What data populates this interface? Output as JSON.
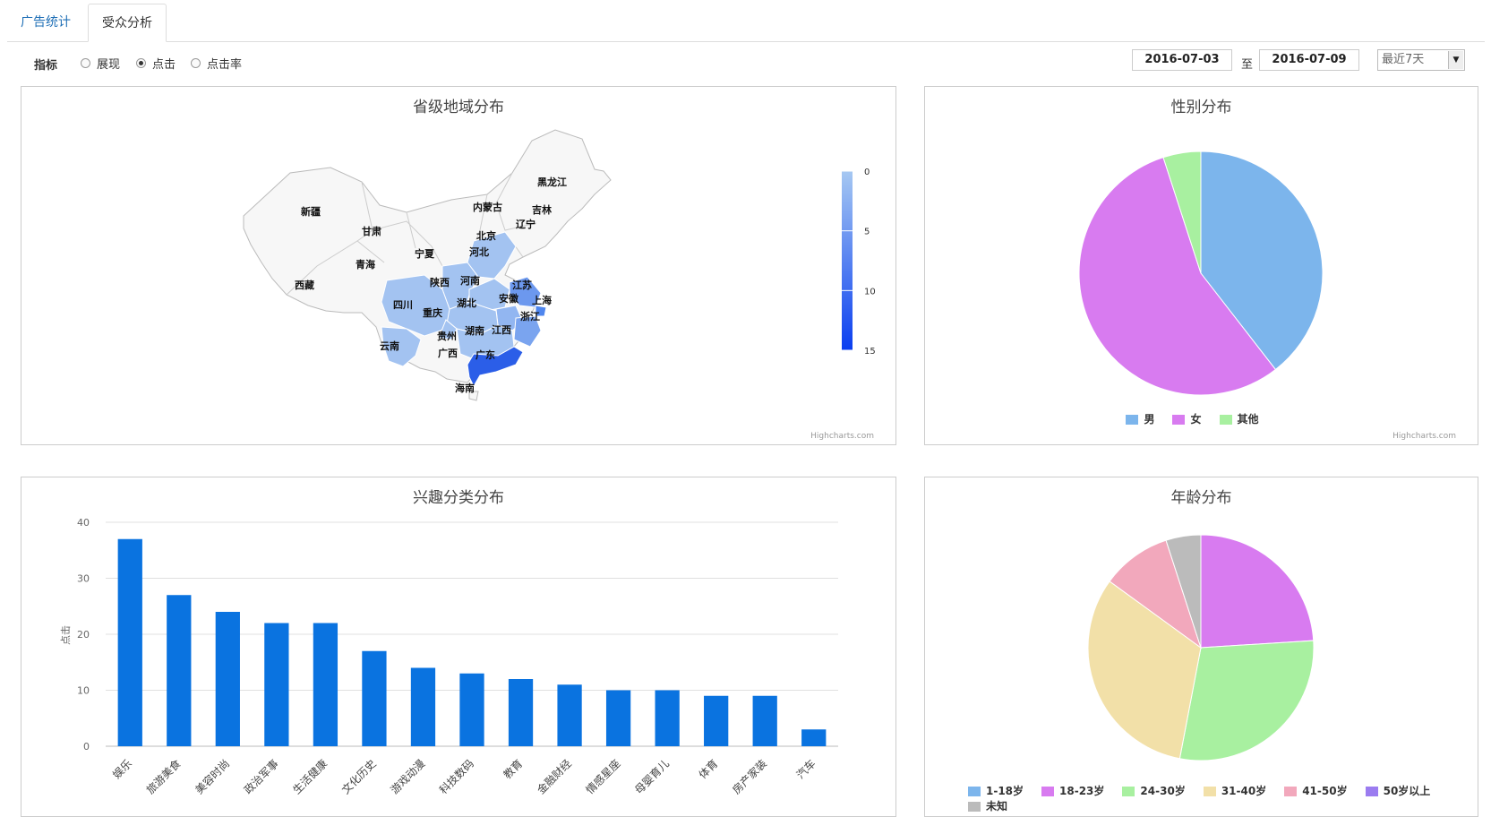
{
  "tabs": [
    {
      "label": "广告统计"
    },
    {
      "label": "受众分析"
    }
  ],
  "filter": {
    "metric_label": "指标",
    "options": [
      {
        "label": "展现",
        "checked": false
      },
      {
        "label": "点击",
        "checked": true
      },
      {
        "label": "点击率",
        "checked": false
      }
    ],
    "start_date": "2016-07-03",
    "to_label": "至",
    "end_date": "2016-07-09",
    "range_select": "最近7天"
  },
  "map_panel": {
    "title": "省级地域分布",
    "credit": "Highcharts.com",
    "colorbar_ticks": [
      "0",
      "5",
      "10",
      "15"
    ],
    "colorbar_colors": [
      "#a6c8f2",
      "#0a3ef0"
    ],
    "provinces": [
      {
        "name": "新疆",
        "value": 0
      },
      {
        "name": "西藏",
        "value": 0
      },
      {
        "name": "甘肃",
        "value": 0
      },
      {
        "name": "青海",
        "value": 0
      },
      {
        "name": "宁夏",
        "value": 0
      },
      {
        "name": "内蒙古",
        "value": 0
      },
      {
        "name": "黑龙江",
        "value": 0
      },
      {
        "name": "吉林",
        "value": 0
      },
      {
        "name": "辽宁",
        "value": 0
      },
      {
        "name": "北京",
        "value": 3
      },
      {
        "name": "河北",
        "value": 3
      },
      {
        "name": "陕西",
        "value": 3
      },
      {
        "name": "河南",
        "value": 3
      },
      {
        "name": "江苏",
        "value": 8
      },
      {
        "name": "上海",
        "value": 9
      },
      {
        "name": "安徽",
        "value": 4
      },
      {
        "name": "湖北",
        "value": 4
      },
      {
        "name": "浙江",
        "value": 6
      },
      {
        "name": "四川",
        "value": 3
      },
      {
        "name": "重庆",
        "value": 3
      },
      {
        "name": "湖南",
        "value": 3
      },
      {
        "name": "江西",
        "value": 4
      },
      {
        "name": "贵州",
        "value": 0
      },
      {
        "name": "云南",
        "value": 3
      },
      {
        "name": "广西",
        "value": 0
      },
      {
        "name": "广东",
        "value": 14
      },
      {
        "name": "海南",
        "value": 0
      }
    ]
  },
  "gender_panel": {
    "title": "性别分布",
    "credit": "Highcharts.com",
    "chart_data": {
      "type": "pie",
      "labels": [
        "男",
        "女",
        "其他"
      ],
      "values": [
        39.5,
        55.5,
        5
      ],
      "colors": [
        "#7cb5ec",
        "#d87bf0",
        "#a8f0a0"
      ]
    }
  },
  "interest_panel": {
    "title": "兴趣分类分布",
    "chart_data": {
      "type": "bar",
      "categories": [
        "娱乐",
        "旅游美食",
        "美容时尚",
        "政治军事",
        "生活健康",
        "文化历史",
        "游戏动漫",
        "科技数码",
        "教育",
        "金融财经",
        "情感星座",
        "母婴育儿",
        "体育",
        "房产家装",
        "汽车"
      ],
      "values": [
        37,
        27,
        24,
        22,
        22,
        17,
        14,
        13,
        12,
        11,
        10,
        10,
        9,
        9,
        3
      ],
      "ylabel": "点击",
      "yticks": [
        0,
        10,
        20,
        30,
        40
      ],
      "ylim": [
        0,
        40
      ],
      "color": "#0a73e0"
    }
  },
  "age_panel": {
    "title": "年龄分布",
    "chart_data": {
      "type": "pie",
      "labels": [
        "1-18岁",
        "18-23岁",
        "24-30岁",
        "31-40岁",
        "41-50岁",
        "50岁以上",
        "未知"
      ],
      "values": [
        0,
        24,
        29,
        32,
        10,
        0,
        5
      ],
      "colors": [
        "#7cb5ec",
        "#d87bf0",
        "#a8f0a0",
        "#f2e0a8",
        "#f2a8bc",
        "#9b7cf0",
        "#bbbbbb"
      ]
    }
  }
}
